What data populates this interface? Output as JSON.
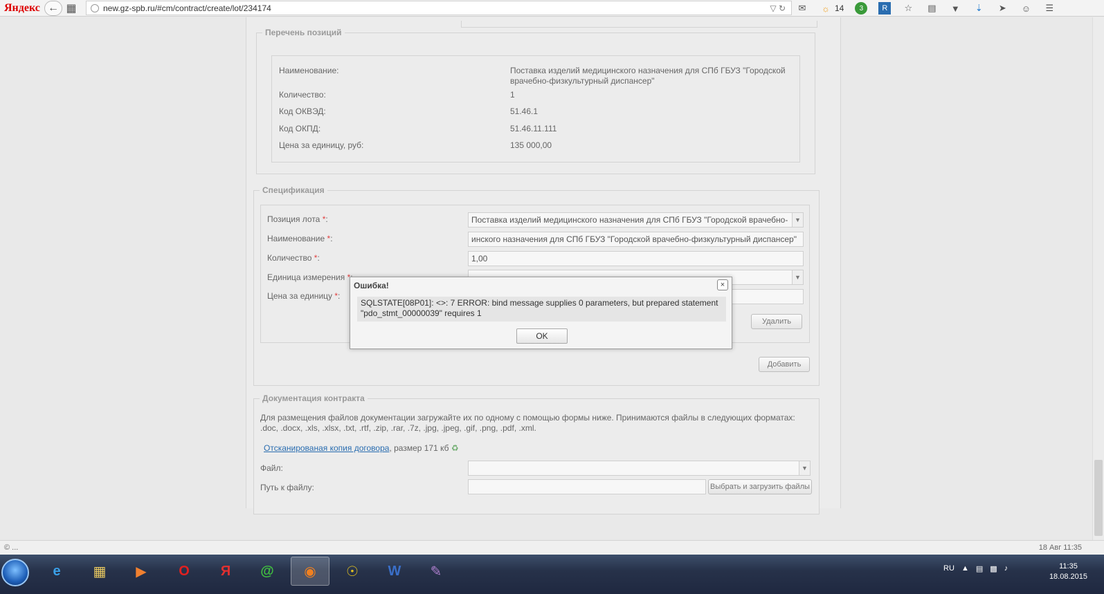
{
  "browser": {
    "logo": "Яндекс",
    "url": "new.gz-spb.ru/#cm/contract/create/lot/234174",
    "weather_temp": "14",
    "badge_count": "3",
    "icons": [
      "back-icon",
      "files-icon",
      "globe-icon",
      "dropdown-icon",
      "reload-icon",
      "mail-icon",
      "weather-icon",
      "counter-icon",
      "bookmark-r-icon",
      "star-icon",
      "clipboard-icon",
      "pocket-icon",
      "download-icon",
      "send-icon",
      "chat-icon",
      "menu-icon"
    ]
  },
  "positions": {
    "legend": "Перечень позиций",
    "rows": [
      {
        "label": "Наименование:",
        "value": "Поставка изделий медицинского назначения для СПб ГБУЗ \"Городской врачебно-физкультурный диспансер\""
      },
      {
        "label": "Количество:",
        "value": "1"
      },
      {
        "label": "Код ОКВЭД:",
        "value": "51.46.1"
      },
      {
        "label": "Код ОКПД:",
        "value": "51.46.11.111"
      },
      {
        "label": "Цена за единицу, руб:",
        "value": "135 000,00"
      }
    ]
  },
  "spec": {
    "legend": "Спецификация",
    "labels": {
      "position": "Позиция лота",
      "name": "Наименование",
      "qty": "Количество",
      "unit": "Единица измерения",
      "price": "Цена за единицу"
    },
    "required_mark": "*",
    "colon": ":",
    "values": {
      "position": "Поставка изделий медицинского назначения для СПб ГБУЗ \"Городской врачебно-",
      "name": "инского назначения для СПб ГБУЗ \"Городской врачебно-физкультурный диспансер\"",
      "qty": "1,00",
      "unit": "",
      "price": ""
    },
    "delete_button": "Удалить",
    "add_button": "Добавить"
  },
  "docs": {
    "legend": "Документация контракта",
    "info": "Для размещения файлов документации загружайте их по одному с помощью формы ниже. Принимаются файлы в следующих форматах: .doc, .docx, .xls, .xlsx, .txt, .rtf, .zip, .rar, .7z, .jpg, .jpeg, .gif, .png, .pdf, .xml.",
    "link_text": "Отсканированая копия договора",
    "link_size": ", размер 171 кб",
    "file_label": "Файл:",
    "path_label": "Путь к файлу:",
    "upload_button": "Выбрать и загрузить файлы"
  },
  "modal": {
    "title": "Ошибка!",
    "message": "SQLSTATE[08P01]: <>: 7 ERROR: bind message supplies 0 parameters, but prepared statement \"pdo_stmt_00000039\" requires 1",
    "ok": "OK",
    "close": "×"
  },
  "status": {
    "left": "© ...",
    "right": "18 Авг 11:35"
  },
  "taskbar": {
    "lang": "RU",
    "time": "11:35",
    "date": "18.08.2015"
  }
}
